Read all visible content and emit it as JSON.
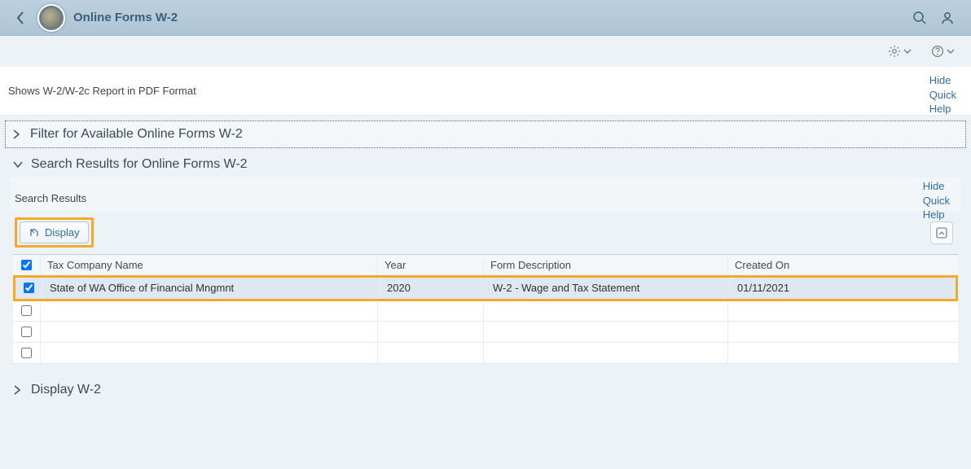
{
  "header": {
    "title": "Online Forms W-2"
  },
  "info": {
    "subtitle": "Shows W-2/W-2c Report in PDF Format",
    "quick_help": "Hide Quick Help"
  },
  "filter_panel": {
    "title": "Filter for Available Online Forms W-2"
  },
  "results_panel": {
    "title": "Search Results for Online Forms W-2",
    "search_results_label": "Search Results",
    "quick_help": "Hide Quick Help",
    "display_button": "Display"
  },
  "columns": {
    "company": "Tax Company Name",
    "year": "Year",
    "desc": "Form Description",
    "created": "Created On"
  },
  "rows": [
    {
      "checked": true,
      "company": "State of WA Office of Financial Mngmnt",
      "year": "2020",
      "desc": "W-2 - Wage and Tax Statement",
      "created": "01/11/2021"
    },
    {
      "checked": false,
      "company": "",
      "year": "",
      "desc": "",
      "created": ""
    },
    {
      "checked": false,
      "company": "",
      "year": "",
      "desc": "",
      "created": ""
    },
    {
      "checked": false,
      "company": "",
      "year": "",
      "desc": "",
      "created": ""
    }
  ],
  "display_panel": {
    "title": "Display W-2"
  }
}
